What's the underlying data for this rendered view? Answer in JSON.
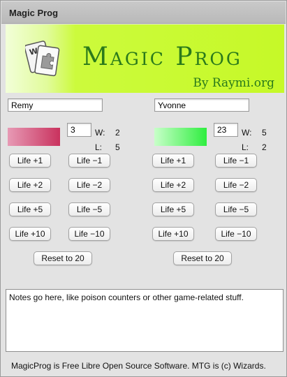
{
  "window": {
    "title": "Magic Prog"
  },
  "banner": {
    "app_name": "Magic Prog",
    "byline": "By Raymi.org",
    "logo_icon": "magic-cards-puzzle-logo"
  },
  "players": [
    {
      "name": "Remy",
      "life": "3",
      "wins_label": "W:",
      "wins": "2",
      "losses_label": "L:",
      "losses": "5",
      "color": "#d9577a"
    },
    {
      "name": "Yvonne",
      "life": "23",
      "wins_label": "W:",
      "wins": "5",
      "losses_label": "L:",
      "losses": "2",
      "color": "#44f052"
    }
  ],
  "buttons": {
    "plus1": "Life +1",
    "minus1": "Life −1",
    "plus2": "Life +2",
    "minus2": "Life −2",
    "plus5": "Life +5",
    "minus5": "Life −5",
    "plus10": "Life +10",
    "minus10": "Life −10",
    "reset": "Reset to 20"
  },
  "notes": {
    "value": "Notes go here, like poison counters or other game-related stuff."
  },
  "footer": {
    "text": "MagicProg is Free Libre Open Source Software. MTG is (c) Wizards."
  }
}
